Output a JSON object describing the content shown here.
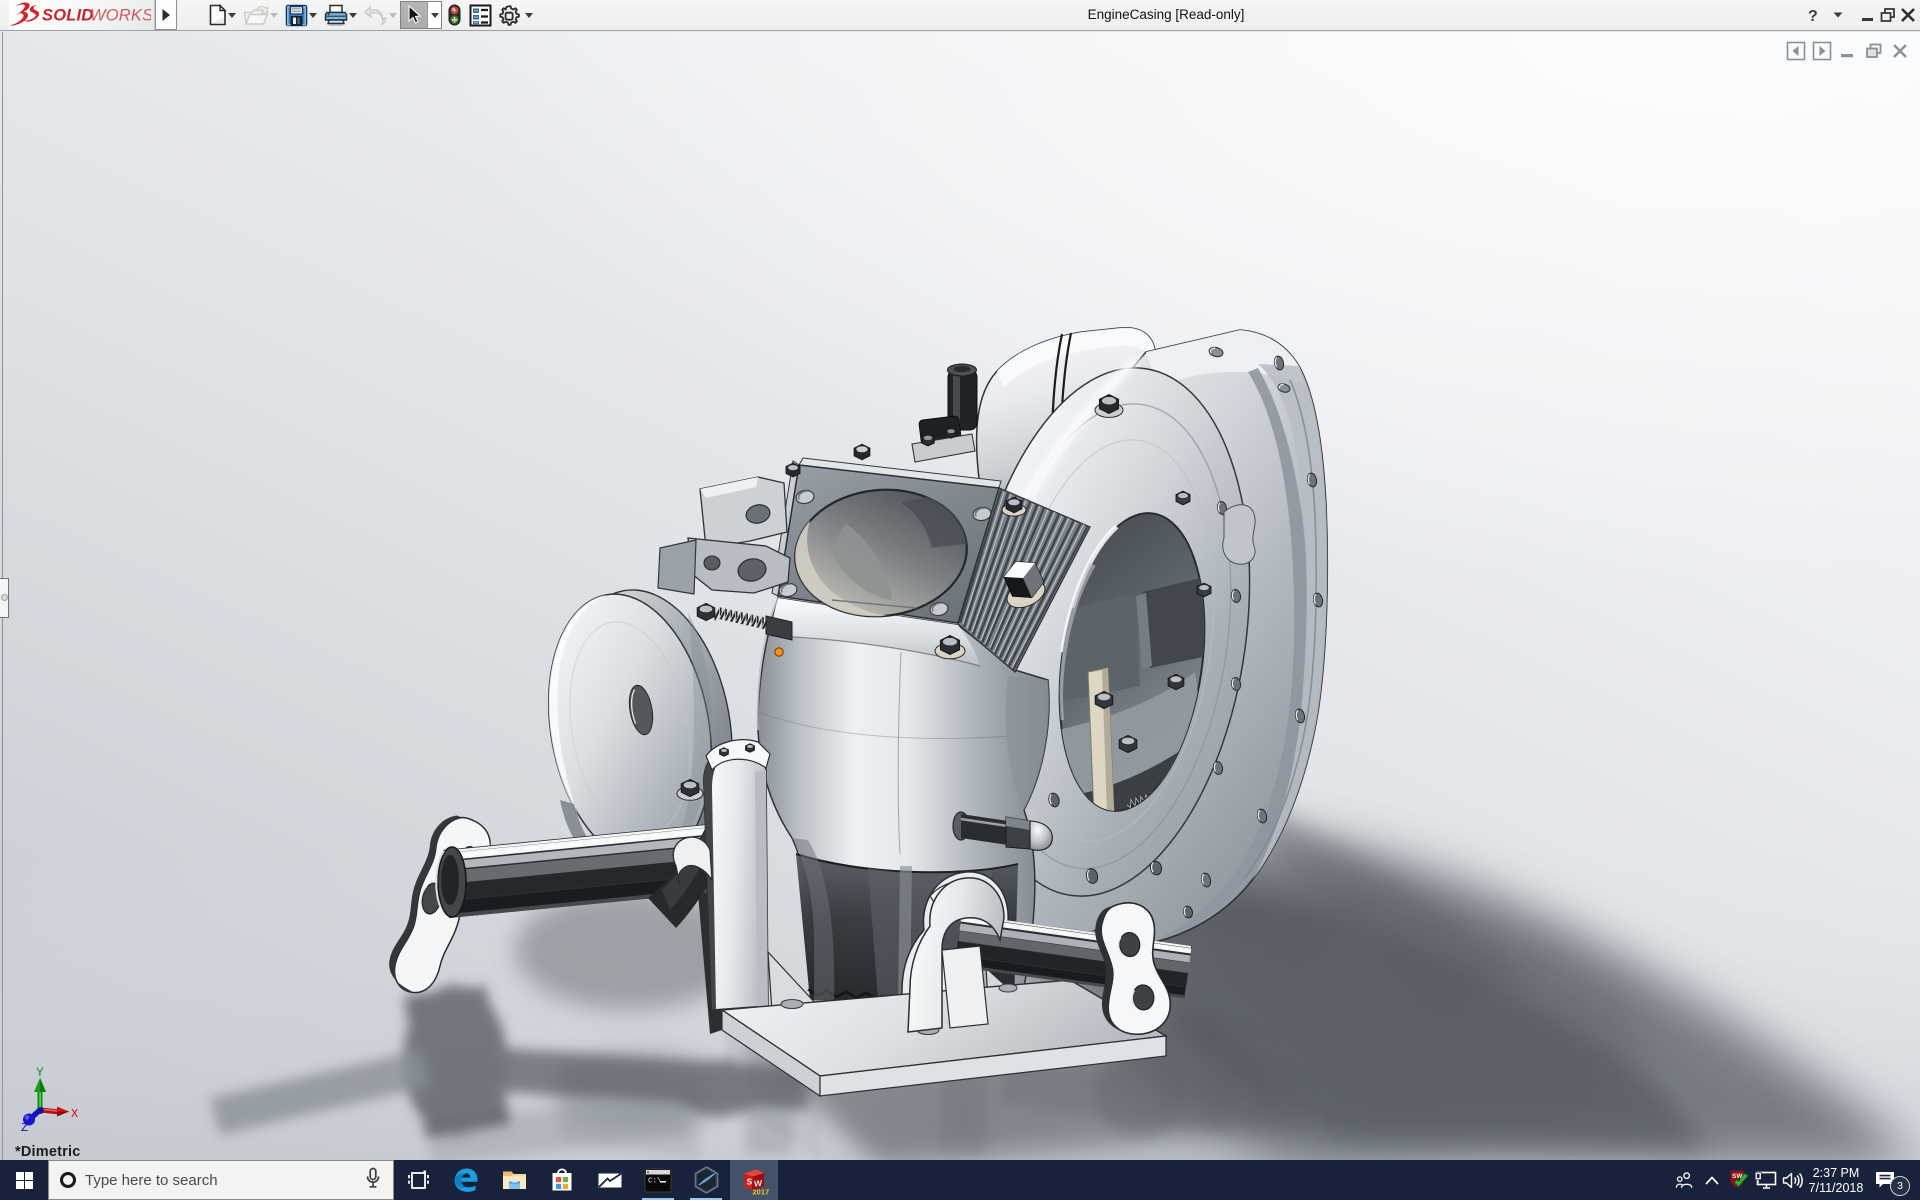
{
  "window": {
    "app_name": "SOLIDWORKS",
    "brand_bold": "SOLID",
    "brand_light": "WORKS",
    "title": "EngineCasing [Read-only]",
    "controls": [
      "help",
      "help-menu",
      "minimize",
      "restore",
      "close"
    ]
  },
  "toolbar": {
    "items": [
      {
        "name": "new",
        "enabled": true,
        "has_dropdown": true
      },
      {
        "name": "open",
        "enabled": false,
        "has_dropdown": true
      },
      {
        "name": "save",
        "enabled": true,
        "has_dropdown": true
      },
      {
        "name": "print",
        "enabled": true,
        "has_dropdown": true
      },
      {
        "name": "undo",
        "enabled": false,
        "has_dropdown": true
      },
      {
        "name": "select",
        "enabled": true,
        "pressed": true,
        "has_dropdown": true
      },
      {
        "name": "rebuild-traffic-light",
        "enabled": true,
        "has_dropdown": false
      },
      {
        "name": "options-list",
        "enabled": true,
        "has_dropdown": false
      },
      {
        "name": "settings-gear",
        "enabled": true,
        "has_dropdown": true
      }
    ]
  },
  "document_window": {
    "controls": [
      "previous-pane",
      "next-pane",
      "minimize",
      "restore",
      "close"
    ]
  },
  "viewport": {
    "view_orientation_label": "*Dimetric",
    "triad_axes": {
      "x": "X",
      "y": "Y",
      "z": "Z"
    },
    "triad_colors": {
      "x": "#cc1111",
      "y": "#0d8a0d",
      "z": "#1111cc"
    },
    "selection_dot_color": "#f07d12",
    "model_name": "EngineCasing"
  },
  "taskbar": {
    "search_placeholder": "Type here to search",
    "apps": [
      {
        "name": "task-view",
        "state": "idle"
      },
      {
        "name": "edge",
        "state": "idle"
      },
      {
        "name": "file-explorer",
        "state": "idle"
      },
      {
        "name": "store",
        "state": "idle"
      },
      {
        "name": "mail",
        "state": "idle"
      },
      {
        "name": "command-prompt",
        "state": "running"
      },
      {
        "name": "solidworks-composer",
        "state": "running"
      },
      {
        "name": "solidworks-2017",
        "state": "active",
        "year": "2017"
      }
    ],
    "tray": {
      "icons": [
        "people",
        "hidden-icons-chevron",
        "solidworks-resource-monitor",
        "network",
        "volume"
      ],
      "time": "2:37 PM",
      "date": "7/11/2018",
      "notification_count": "3"
    }
  }
}
